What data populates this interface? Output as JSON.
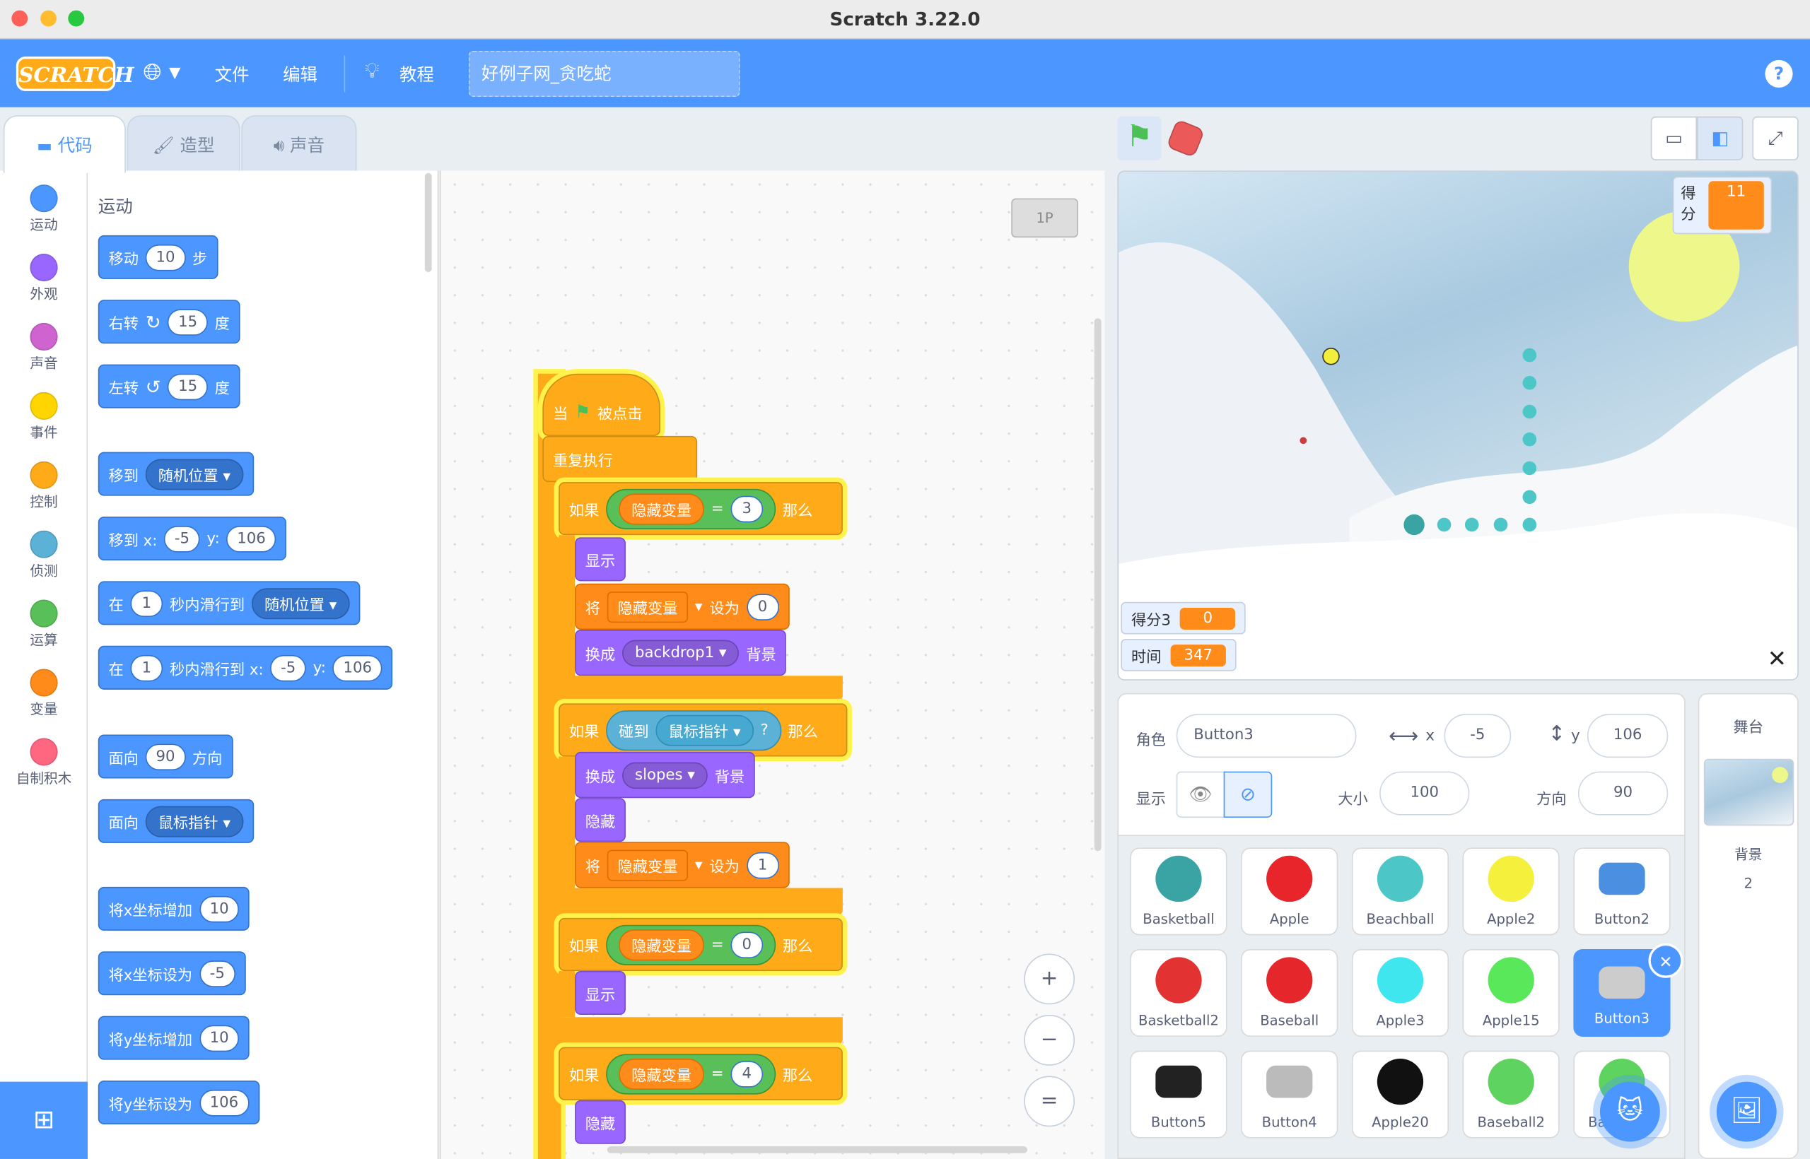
{
  "window": {
    "title": "Scratch 3.22.0"
  },
  "menubar": {
    "logo": "SCRATCH",
    "file": "文件",
    "edit": "编辑",
    "tutorials": "教程",
    "project_title": "好例子网_贪吃蛇",
    "help": "?"
  },
  "tabs": {
    "code": "代码",
    "costumes": "造型",
    "sounds": "声音"
  },
  "categories": [
    {
      "label": "运动",
      "color": "#4c97ff"
    },
    {
      "label": "外观",
      "color": "#9966ff"
    },
    {
      "label": "声音",
      "color": "#cf63cf"
    },
    {
      "label": "事件",
      "color": "#ffd500"
    },
    {
      "label": "控制",
      "color": "#ffab19"
    },
    {
      "label": "侦测",
      "color": "#5cb1d6"
    },
    {
      "label": "运算",
      "color": "#59c059"
    },
    {
      "label": "变量",
      "color": "#ff8c1a"
    },
    {
      "label": "自制积木",
      "color": "#ff6680"
    }
  ],
  "palette": {
    "section_title": "运动",
    "move": {
      "pre": "移动",
      "val": "10",
      "post": "步"
    },
    "turn_right": {
      "pre": "右转",
      "icon": "↻",
      "val": "15",
      "post": "度"
    },
    "turn_left": {
      "pre": "左转",
      "icon": "↺",
      "val": "15",
      "post": "度"
    },
    "goto": {
      "pre": "移到",
      "dd": "随机位置 ▾"
    },
    "goto_xy": {
      "pre": "移到 x:",
      "x": "-5",
      "ymid": "y:",
      "y": "106"
    },
    "glide": {
      "pre": "在",
      "val": "1",
      "mid": "秒内滑行到",
      "dd": "随机位置 ▾"
    },
    "glide_xy": {
      "pre": "在",
      "val": "1",
      "mid": "秒内滑行到 x:",
      "x": "-5",
      "ymid": "y:",
      "y": "106"
    },
    "point": {
      "pre": "面向",
      "val": "90",
      "post": "方向"
    },
    "point_towards": {
      "pre": "面向",
      "dd": "鼠标指针 ▾"
    },
    "change_x": {
      "pre": "将x坐标增加",
      "val": "10"
    },
    "set_x": {
      "pre": "将x坐标设为",
      "val": "-5"
    },
    "change_y": {
      "pre": "将y坐标增加",
      "val": "10"
    },
    "set_y": {
      "pre": "将y坐标设为",
      "val": "106"
    }
  },
  "script": {
    "sprite_badge": "1P",
    "hat": {
      "pre": "当",
      "post": "被点击"
    },
    "forever": "重复执行",
    "if_label": "如果",
    "then_label": "那么",
    "var_name": "隐藏变量",
    "eq": "=",
    "if1_val": "3",
    "show": "显示",
    "hide": "隐藏",
    "set_label": "将",
    "set_to": "设为",
    "set1_val": "0",
    "switch_label": "换成",
    "backdrop_label": "背景",
    "backdrop1": "backdrop1",
    "touching": "碰到",
    "mouse": "鼠标指针",
    "question": "?",
    "slopes": "slopes",
    "set2_val": "1",
    "if3_val": "0",
    "if4_val": "4",
    "zoom_in": "+",
    "zoom_out": "−",
    "zoom_reset": "="
  },
  "stage": {
    "score_label": "得分",
    "score_val": "11",
    "score3_label": "得分3",
    "score3_val": "0",
    "time_label": "时间",
    "time_val": "347"
  },
  "sprite_info": {
    "sprite_label": "角色",
    "sprite_name": "Button3",
    "x_label": "x",
    "x_val": "-5",
    "y_label": "y",
    "y_val": "106",
    "show_label": "显示",
    "size_label": "大小",
    "size_val": "100",
    "dir_label": "方向",
    "dir_val": "90"
  },
  "sprites": [
    {
      "name": "Basketball",
      "color": "#3aa3a3"
    },
    {
      "name": "Apple",
      "color": "#e8252b"
    },
    {
      "name": "Beachball",
      "color": "#4cc6c6"
    },
    {
      "name": "Apple2",
      "color": "#f5f03b"
    },
    {
      "name": "Button2",
      "color": "#4a8fe0"
    },
    {
      "name": "Basketball2",
      "color": "#e23232"
    },
    {
      "name": "Baseball",
      "color": "#e5262a"
    },
    {
      "name": "Apple3",
      "color": "#3fe6ee"
    },
    {
      "name": "Apple15",
      "color": "#58e85a"
    },
    {
      "name": "Button3",
      "color": "#cccccc"
    },
    {
      "name": "Button5",
      "color": "#222222"
    },
    {
      "name": "Button4",
      "color": "#bbbbbb"
    },
    {
      "name": "Apple20",
      "color": "#111111"
    },
    {
      "name": "Baseball2",
      "color": "#5fd35f"
    },
    {
      "name": "Baseball3",
      "color": "#5fd35f"
    }
  ],
  "stage_panel": {
    "title": "舞台",
    "backdrops_label": "背景",
    "backdrops_count": "2"
  }
}
